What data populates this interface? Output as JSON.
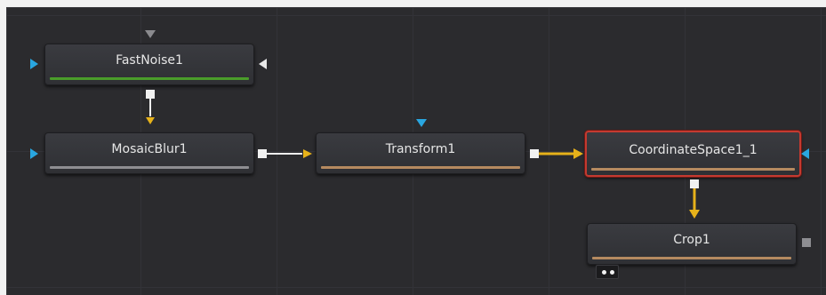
{
  "colors": {
    "link_white": "#f1f1f1",
    "link_yellow": "#e7b21a",
    "input_blue": "#29a6e0",
    "selection_red": "#c43a30"
  },
  "nodes": {
    "fastnoise": {
      "label": "FastNoise1",
      "bar_color": "#4a9d2a"
    },
    "mosaicblur": {
      "label": "MosaicBlur1",
      "bar_color": "#8e8e92"
    },
    "transform": {
      "label": "Transform1",
      "bar_color": "#b58a60"
    },
    "coordspace": {
      "label": "CoordinateSpace1_1",
      "bar_color": "#b58a60",
      "selected": true
    },
    "crop": {
      "label": "Crop1",
      "bar_color": "#b58a60"
    }
  },
  "icons": {
    "input": "triangle-pointer-icon",
    "output": "square-output-icon",
    "view_indicator": "view-dots-icon"
  }
}
